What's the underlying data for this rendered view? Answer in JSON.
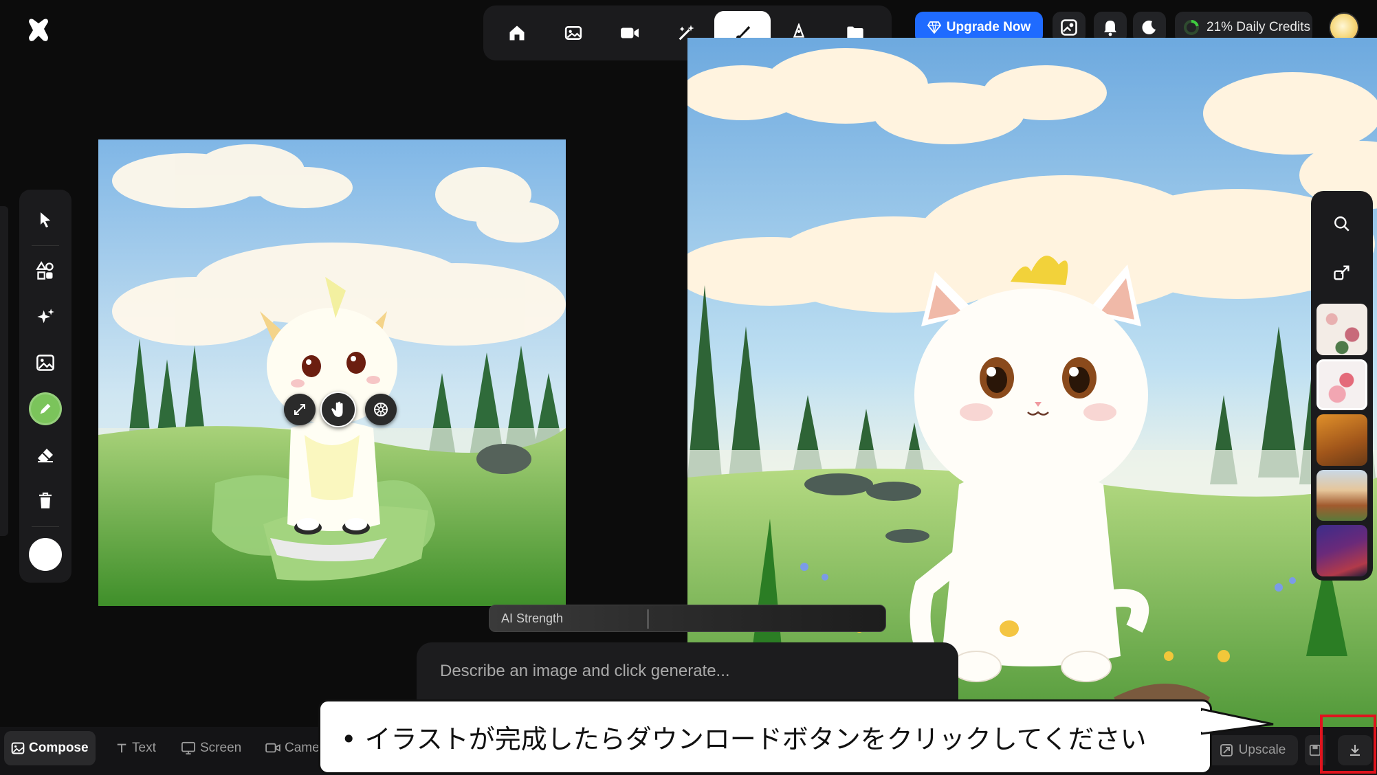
{
  "topnav": {
    "items": [
      {
        "icon": "home-icon"
      },
      {
        "icon": "image-icon"
      },
      {
        "icon": "video-icon"
      },
      {
        "icon": "magic-wand-icon"
      },
      {
        "icon": "brush-icon",
        "active": true
      },
      {
        "icon": "pen-nib-icon"
      },
      {
        "icon": "folder-icon"
      }
    ]
  },
  "header": {
    "upgrade_label": "Upgrade Now",
    "credits_label": "21% Daily Credits",
    "credits_percent": 21,
    "accent_color": "#1f6bff"
  },
  "left_tools": {
    "items": [
      "select-arrow-icon",
      "shapes-icon",
      "sparkles-icon",
      "image-icon",
      "color-swatch",
      "eraser-icon",
      "trash-icon",
      "brush-size-swatch"
    ],
    "swatch_color": "#7bc45b"
  },
  "canvas_actions": [
    "expand-icon",
    "pan-hand-icon",
    "settings-wheel-icon"
  ],
  "right_panel": {
    "buttons": [
      "search-icon",
      "export-icon"
    ],
    "thumbnails": [
      "floral-pattern",
      "pink-flowers",
      "orange-landscape",
      "cottage-scene",
      "purple-abstract"
    ]
  },
  "ai_strength": {
    "label": "AI Strength",
    "value": 0.4
  },
  "prompt": {
    "placeholder": "Describe an image and click generate..."
  },
  "bottom_tabs": [
    {
      "label": "Compose",
      "icon": "image-icon",
      "active": true
    },
    {
      "label": "Text",
      "icon": "text-icon"
    },
    {
      "label": "Screen",
      "icon": "monitor-icon"
    },
    {
      "label": "Came",
      "icon": "camera-icon"
    }
  ],
  "bottom_right": {
    "upscale_label": "Upscale"
  },
  "callout": {
    "text": "• イラストが完成したらダウンロードボタンをクリックしてください"
  },
  "highlight_color": "#e0141e"
}
